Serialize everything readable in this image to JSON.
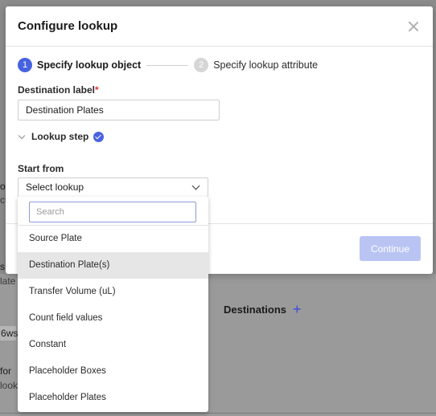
{
  "background": {
    "partial_texts": [
      "ol",
      "ct",
      "s",
      "late",
      "ws",
      "for",
      "look"
    ],
    "tag": "6",
    "destinations_label": "Destinations",
    "add_icon": "plus-icon"
  },
  "modal": {
    "title": "Configure lookup",
    "close_icon": "close-icon",
    "steps": [
      {
        "number": "1",
        "label": "Specify lookup object",
        "state": "active"
      },
      {
        "number": "2",
        "label": "Specify lookup attribute",
        "state": "inactive"
      }
    ],
    "destination_label": {
      "label": "Destination label",
      "required_mark": "*",
      "value": "Destination Plates"
    },
    "lookup_step": {
      "label": "Lookup step",
      "status_icon": "check-circle-icon"
    },
    "start_from": {
      "label": "Start from",
      "selected": "Select lookup"
    },
    "continue_label": "Continue",
    "accent_color": "#4863e0"
  },
  "dropdown": {
    "search_placeholder": "Search",
    "search_value": "",
    "items": [
      {
        "label": "Source Plate",
        "selected": false
      },
      {
        "label": "Destination Plate(s)",
        "selected": true
      },
      {
        "label": "Transfer Volume (uL)",
        "selected": false
      },
      {
        "label": "Count field values",
        "selected": false
      },
      {
        "label": "Constant",
        "selected": false
      },
      {
        "label": "Placeholder Boxes",
        "selected": false
      },
      {
        "label": "Placeholder Plates",
        "selected": false
      }
    ]
  }
}
